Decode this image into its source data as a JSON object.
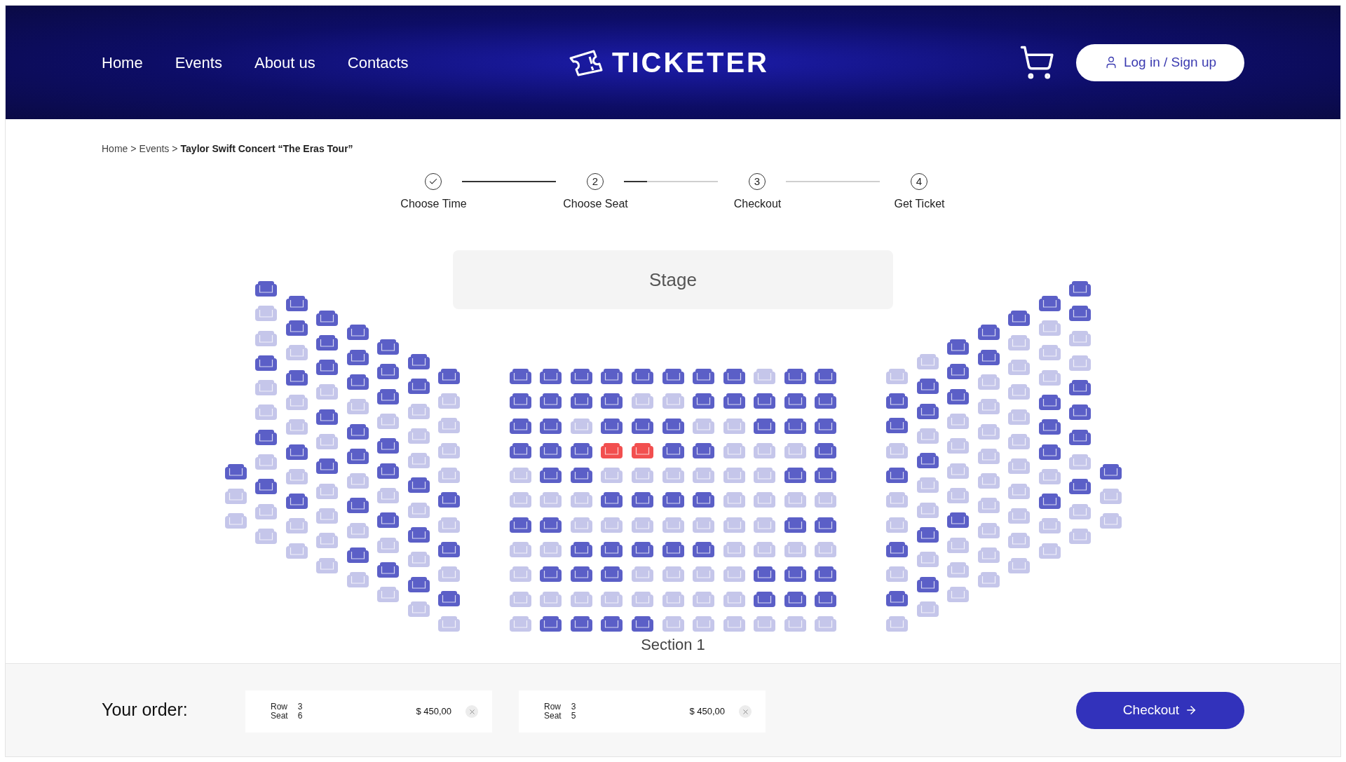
{
  "header": {
    "nav": [
      "Home",
      "Events",
      "About us",
      "Contacts"
    ],
    "logo": "TICKETER",
    "login": "Log in / Sign up"
  },
  "breadcrumb": {
    "items": [
      "Home",
      "Events"
    ],
    "separator": ">",
    "current": "Taylor Swift Concert “The Eras Tour”"
  },
  "steps": [
    {
      "label": "Choose Time",
      "done": true
    },
    {
      "number": "2",
      "label": "Choose Seat",
      "done": false
    },
    {
      "number": "3",
      "label": "Checkout",
      "done": false
    },
    {
      "number": "4",
      "label": "Get Ticket",
      "done": false
    }
  ],
  "seat_map": {
    "stage": "Stage",
    "section_label": "Section 1",
    "left_wing": [
      [
        {
          "taken": false,
          "selected": false
        },
        {
          "taken": true,
          "selected": false
        },
        {
          "taken": true,
          "selected": false
        }
      ],
      [
        {
          "taken": false,
          "selected": false
        },
        {
          "taken": true,
          "selected": false
        },
        {
          "taken": true,
          "selected": false
        },
        {
          "taken": false,
          "selected": false
        },
        {
          "taken": true,
          "selected": false
        },
        {
          "taken": true,
          "selected": false
        },
        {
          "taken": false,
          "selected": false
        },
        {
          "taken": true,
          "selected": false
        },
        {
          "taken": false,
          "selected": false
        },
        {
          "taken": true,
          "selected": false
        },
        {
          "taken": true,
          "selected": false
        }
      ],
      [
        {
          "taken": false,
          "selected": false
        },
        {
          "taken": false,
          "selected": false
        },
        {
          "taken": true,
          "selected": false
        },
        {
          "taken": false,
          "selected": false
        },
        {
          "taken": true,
          "selected": false
        },
        {
          "taken": true,
          "selected": false
        },
        {
          "taken": false,
          "selected": false
        },
        {
          "taken": true,
          "selected": false
        },
        {
          "taken": false,
          "selected": false
        },
        {
          "taken": true,
          "selected": false
        },
        {
          "taken": true,
          "selected": false
        }
      ],
      [
        {
          "taken": false,
          "selected": false
        },
        {
          "taken": false,
          "selected": false
        },
        {
          "taken": false,
          "selected": false
        },
        {
          "taken": true,
          "selected": false
        },
        {
          "taken": false,
          "selected": false
        },
        {
          "taken": true,
          "selected": false
        },
        {
          "taken": false,
          "selected": false
        },
        {
          "taken": true,
          "selected": false
        },
        {
          "taken": true,
          "selected": false
        },
        {
          "taken": true,
          "selected": false
        },
        {
          "taken": true,
          "selected": false
        }
      ],
      [
        {
          "taken": false,
          "selected": false
        },
        {
          "taken": false,
          "selected": false
        },
        {
          "taken": false,
          "selected": false
        },
        {
          "taken": true,
          "selected": false
        },
        {
          "taken": false,
          "selected": false
        },
        {
          "taken": false,
          "selected": false
        },
        {
          "taken": true,
          "selected": false
        },
        {
          "taken": false,
          "selected": false
        },
        {
          "taken": true,
          "selected": false
        },
        {
          "taken": false,
          "selected": false
        },
        {
          "taken": true,
          "selected": false
        }
      ],
      [
        {
          "taken": false,
          "selected": false
        },
        {
          "taken": false,
          "selected": false
        },
        {
          "taken": false,
          "selected": false
        },
        {
          "taken": true,
          "selected": false
        },
        {
          "taken": false,
          "selected": false
        },
        {
          "taken": false,
          "selected": false
        },
        {
          "taken": true,
          "selected": false
        },
        {
          "taken": false,
          "selected": false
        },
        {
          "taken": true,
          "selected": false
        },
        {
          "taken": false,
          "selected": false
        },
        {
          "taken": true,
          "selected": false
        }
      ],
      [
        {
          "taken": false,
          "selected": false
        },
        {
          "taken": false,
          "selected": false
        },
        {
          "taken": true,
          "selected": false
        },
        {
          "taken": true,
          "selected": false
        },
        {
          "taken": true,
          "selected": false
        },
        {
          "taken": false,
          "selected": false
        },
        {
          "taken": true,
          "selected": false
        },
        {
          "taken": false,
          "selected": false
        },
        {
          "taken": true,
          "selected": false
        },
        {
          "taken": false,
          "selected": false
        },
        {
          "taken": true,
          "selected": false
        }
      ],
      [
        {
          "taken": false,
          "selected": false
        },
        {
          "taken": true,
          "selected": false
        },
        {
          "taken": true,
          "selected": false
        },
        {
          "taken": true,
          "selected": false
        },
        {
          "taken": true,
          "selected": false
        },
        {
          "taken": false,
          "selected": false
        },
        {
          "taken": true,
          "selected": false
        },
        {
          "taken": false,
          "selected": false
        },
        {
          "taken": true,
          "selected": false
        },
        {
          "taken": false,
          "selected": false
        },
        {
          "taken": true,
          "selected": false
        }
      ]
    ],
    "center": [
      [
        {
          "taken": false,
          "selected": false
        },
        {
          "taken": false,
          "selected": false
        },
        {
          "taken": false,
          "selected": false
        },
        {
          "taken": false,
          "selected": false
        },
        {
          "taken": false,
          "selected": false
        },
        {
          "taken": false,
          "selected": false
        },
        {
          "taken": false,
          "selected": false
        },
        {
          "taken": false,
          "selected": false
        },
        {
          "taken": true,
          "selected": false
        },
        {
          "taken": false,
          "selected": false
        },
        {
          "taken": false,
          "selected": false
        }
      ],
      [
        {
          "taken": false,
          "selected": false
        },
        {
          "taken": false,
          "selected": false
        },
        {
          "taken": false,
          "selected": false
        },
        {
          "taken": false,
          "selected": false
        },
        {
          "taken": true,
          "selected": false
        },
        {
          "taken": true,
          "selected": false
        },
        {
          "taken": false,
          "selected": false
        },
        {
          "taken": false,
          "selected": false
        },
        {
          "taken": false,
          "selected": false
        },
        {
          "taken": false,
          "selected": false
        },
        {
          "taken": false,
          "selected": false
        }
      ],
      [
        {
          "taken": false,
          "selected": false
        },
        {
          "taken": false,
          "selected": false
        },
        {
          "taken": true,
          "selected": false
        },
        {
          "taken": false,
          "selected": false
        },
        {
          "taken": false,
          "selected": false
        },
        {
          "taken": false,
          "selected": false
        },
        {
          "taken": true,
          "selected": false
        },
        {
          "taken": true,
          "selected": false
        },
        {
          "taken": false,
          "selected": false
        },
        {
          "taken": false,
          "selected": false
        },
        {
          "taken": false,
          "selected": false
        }
      ],
      [
        {
          "taken": false,
          "selected": false
        },
        {
          "taken": false,
          "selected": false
        },
        {
          "taken": false,
          "selected": false
        },
        {
          "taken": false,
          "selected": true
        },
        {
          "taken": false,
          "selected": true
        },
        {
          "taken": false,
          "selected": false
        },
        {
          "taken": false,
          "selected": false
        },
        {
          "taken": true,
          "selected": false
        },
        {
          "taken": true,
          "selected": false
        },
        {
          "taken": true,
          "selected": false
        },
        {
          "taken": false,
          "selected": false
        }
      ],
      [
        {
          "taken": true,
          "selected": false
        },
        {
          "taken": false,
          "selected": false
        },
        {
          "taken": false,
          "selected": false
        },
        {
          "taken": true,
          "selected": false
        },
        {
          "taken": true,
          "selected": false
        },
        {
          "taken": true,
          "selected": false
        },
        {
          "taken": true,
          "selected": false
        },
        {
          "taken": true,
          "selected": false
        },
        {
          "taken": true,
          "selected": false
        },
        {
          "taken": false,
          "selected": false
        },
        {
          "taken": false,
          "selected": false
        }
      ],
      [
        {
          "taken": true,
          "selected": false
        },
        {
          "taken": true,
          "selected": false
        },
        {
          "taken": true,
          "selected": false
        },
        {
          "taken": false,
          "selected": false
        },
        {
          "taken": false,
          "selected": false
        },
        {
          "taken": false,
          "selected": false
        },
        {
          "taken": false,
          "selected": false
        },
        {
          "taken": true,
          "selected": false
        },
        {
          "taken": true,
          "selected": false
        },
        {
          "taken": true,
          "selected": false
        },
        {
          "taken": true,
          "selected": false
        }
      ],
      [
        {
          "taken": false,
          "selected": false
        },
        {
          "taken": false,
          "selected": false
        },
        {
          "taken": true,
          "selected": false
        },
        {
          "taken": true,
          "selected": false
        },
        {
          "taken": true,
          "selected": false
        },
        {
          "taken": true,
          "selected": false
        },
        {
          "taken": true,
          "selected": false
        },
        {
          "taken": true,
          "selected": false
        },
        {
          "taken": true,
          "selected": false
        },
        {
          "taken": false,
          "selected": false
        },
        {
          "taken": false,
          "selected": false
        }
      ],
      [
        {
          "taken": true,
          "selected": false
        },
        {
          "taken": true,
          "selected": false
        },
        {
          "taken": false,
          "selected": false
        },
        {
          "taken": false,
          "selected": false
        },
        {
          "taken": false,
          "selected": false
        },
        {
          "taken": false,
          "selected": false
        },
        {
          "taken": false,
          "selected": false
        },
        {
          "taken": true,
          "selected": false
        },
        {
          "taken": true,
          "selected": false
        },
        {
          "taken": true,
          "selected": false
        },
        {
          "taken": true,
          "selected": false
        }
      ],
      [
        {
          "taken": true,
          "selected": false
        },
        {
          "taken": false,
          "selected": false
        },
        {
          "taken": false,
          "selected": false
        },
        {
          "taken": false,
          "selected": false
        },
        {
          "taken": true,
          "selected": false
        },
        {
          "taken": true,
          "selected": false
        },
        {
          "taken": true,
          "selected": false
        },
        {
          "taken": true,
          "selected": false
        },
        {
          "taken": false,
          "selected": false
        },
        {
          "taken": false,
          "selected": false
        },
        {
          "taken": false,
          "selected": false
        }
      ],
      [
        {
          "taken": true,
          "selected": false
        },
        {
          "taken": true,
          "selected": false
        },
        {
          "taken": true,
          "selected": false
        },
        {
          "taken": true,
          "selected": false
        },
        {
          "taken": true,
          "selected": false
        },
        {
          "taken": true,
          "selected": false
        },
        {
          "taken": true,
          "selected": false
        },
        {
          "taken": true,
          "selected": false
        },
        {
          "taken": false,
          "selected": false
        },
        {
          "taken": false,
          "selected": false
        },
        {
          "taken": false,
          "selected": false
        }
      ],
      [
        {
          "taken": true,
          "selected": false
        },
        {
          "taken": false,
          "selected": false
        },
        {
          "taken": false,
          "selected": false
        },
        {
          "taken": false,
          "selected": false
        },
        {
          "taken": false,
          "selected": false
        },
        {
          "taken": true,
          "selected": false
        },
        {
          "taken": true,
          "selected": false
        },
        {
          "taken": true,
          "selected": false
        },
        {
          "taken": true,
          "selected": false
        },
        {
          "taken": true,
          "selected": false
        },
        {
          "taken": true,
          "selected": false
        }
      ]
    ],
    "right_wing": [
      [
        {
          "taken": true,
          "selected": false
        },
        {
          "taken": false,
          "selected": false
        },
        {
          "taken": false,
          "selected": false
        },
        {
          "taken": true,
          "selected": false
        },
        {
          "taken": false,
          "selected": false
        },
        {
          "taken": true,
          "selected": false
        },
        {
          "taken": true,
          "selected": false
        },
        {
          "taken": false,
          "selected": false
        },
        {
          "taken": true,
          "selected": false
        },
        {
          "taken": false,
          "selected": false
        },
        {
          "taken": true,
          "selected": false
        }
      ],
      [
        {
          "taken": true,
          "selected": false
        },
        {
          "taken": false,
          "selected": false
        },
        {
          "taken": false,
          "selected": false
        },
        {
          "taken": true,
          "selected": false
        },
        {
          "taken": false,
          "selected": false
        },
        {
          "taken": true,
          "selected": false
        },
        {
          "taken": true,
          "selected": false
        },
        {
          "taken": false,
          "selected": false
        },
        {
          "taken": true,
          "selected": false
        },
        {
          "taken": false,
          "selected": false
        },
        {
          "taken": true,
          "selected": false
        }
      ],
      [
        {
          "taken": false,
          "selected": false
        },
        {
          "taken": false,
          "selected": false
        },
        {
          "taken": false,
          "selected": false
        },
        {
          "taken": true,
          "selected": false
        },
        {
          "taken": true,
          "selected": false
        },
        {
          "taken": true,
          "selected": false
        },
        {
          "taken": true,
          "selected": false
        },
        {
          "taken": false,
          "selected": false
        },
        {
          "taken": true,
          "selected": false
        },
        {
          "taken": true,
          "selected": false
        },
        {
          "taken": true,
          "selected": false
        }
      ],
      [
        {
          "taken": false,
          "selected": false
        },
        {
          "taken": false,
          "selected": false
        },
        {
          "taken": true,
          "selected": false
        },
        {
          "taken": true,
          "selected": false
        },
        {
          "taken": true,
          "selected": false
        },
        {
          "taken": true,
          "selected": false
        },
        {
          "taken": true,
          "selected": false
        },
        {
          "taken": true,
          "selected": false
        },
        {
          "taken": true,
          "selected": false
        },
        {
          "taken": true,
          "selected": false
        },
        {
          "taken": true,
          "selected": false
        }
      ],
      [
        {
          "taken": false,
          "selected": false
        },
        {
          "taken": true,
          "selected": false
        },
        {
          "taken": true,
          "selected": false
        },
        {
          "taken": true,
          "selected": false
        },
        {
          "taken": true,
          "selected": false
        },
        {
          "taken": true,
          "selected": false
        },
        {
          "taken": true,
          "selected": false
        },
        {
          "taken": true,
          "selected": false
        },
        {
          "taken": true,
          "selected": false
        },
        {
          "taken": true,
          "selected": false
        },
        {
          "taken": true,
          "selected": false
        }
      ],
      [
        {
          "taken": false,
          "selected": false
        },
        {
          "taken": true,
          "selected": false
        },
        {
          "taken": true,
          "selected": false
        },
        {
          "taken": true,
          "selected": false
        },
        {
          "taken": false,
          "selected": false
        },
        {
          "taken": false,
          "selected": false
        },
        {
          "taken": false,
          "selected": false
        },
        {
          "taken": true,
          "selected": false
        },
        {
          "taken": false,
          "selected": false
        },
        {
          "taken": true,
          "selected": false
        },
        {
          "taken": true,
          "selected": false
        }
      ],
      [
        {
          "taken": false,
          "selected": false
        },
        {
          "taken": false,
          "selected": false
        },
        {
          "taken": true,
          "selected": false
        },
        {
          "taken": true,
          "selected": false
        },
        {
          "taken": false,
          "selected": false
        },
        {
          "taken": false,
          "selected": false
        },
        {
          "taken": false,
          "selected": false
        },
        {
          "taken": true,
          "selected": false
        },
        {
          "taken": false,
          "selected": false
        },
        {
          "taken": true,
          "selected": false
        },
        {
          "taken": true,
          "selected": false
        }
      ],
      [
        {
          "taken": false,
          "selected": false
        },
        {
          "taken": true,
          "selected": false
        },
        {
          "taken": true,
          "selected": false
        }
      ]
    ]
  },
  "order": {
    "label": "Your order:",
    "tickets": [
      {
        "row_label": "Row",
        "row": "3",
        "seat_label": "Seat",
        "seat": "6",
        "price": "$ 450,00"
      },
      {
        "row_label": "Row",
        "row": "3",
        "seat_label": "Seat",
        "seat": "5",
        "price": "$ 450,00"
      }
    ],
    "checkout": "Checkout"
  }
}
